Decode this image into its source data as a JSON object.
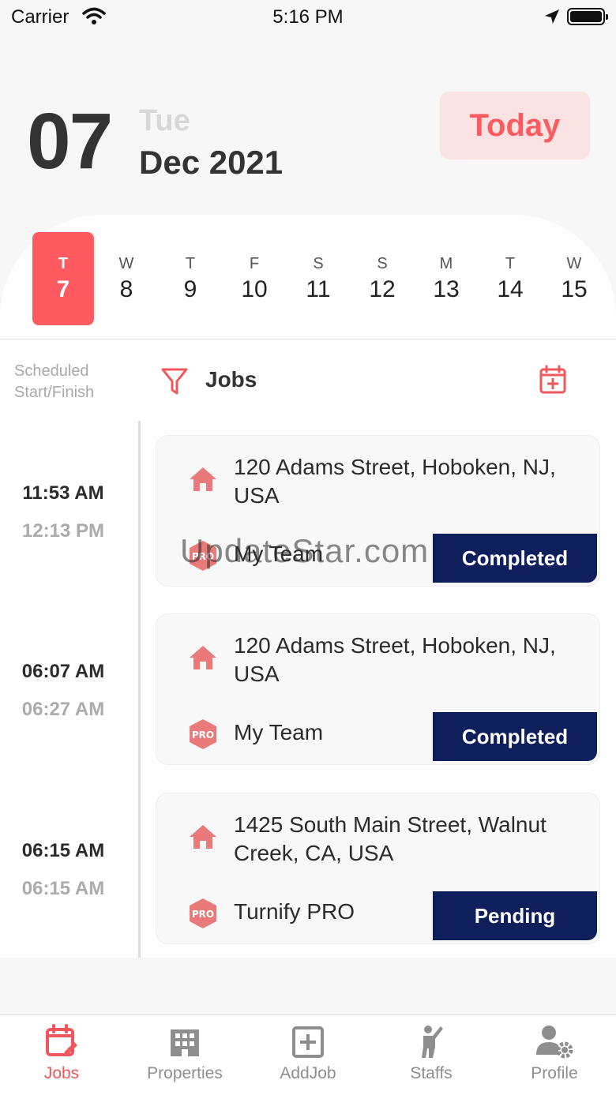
{
  "status_bar": {
    "carrier": "Carrier",
    "time": "5:16 PM"
  },
  "header": {
    "day_number": "07",
    "weekday": "Tue",
    "month_year": "Dec 2021",
    "today_label": "Today"
  },
  "week": [
    {
      "letter": "T",
      "num": "7",
      "active": true
    },
    {
      "letter": "W",
      "num": "8"
    },
    {
      "letter": "T",
      "num": "9"
    },
    {
      "letter": "F",
      "num": "10"
    },
    {
      "letter": "S",
      "num": "11"
    },
    {
      "letter": "S",
      "num": "12"
    },
    {
      "letter": "M",
      "num": "13"
    },
    {
      "letter": "T",
      "num": "14"
    },
    {
      "letter": "W",
      "num": "15"
    }
  ],
  "jobs_section": {
    "sched_label_1": "Scheduled",
    "sched_label_2": "Start/Finish",
    "title": "Jobs"
  },
  "jobs": [
    {
      "start": "11:53 AM",
      "end": "12:13 PM",
      "address": "120 Adams Street, Hoboken, NJ, USA",
      "team": "My Team",
      "status": "Completed"
    },
    {
      "start": "06:07 AM",
      "end": "06:27 AM",
      "address": "120 Adams Street, Hoboken, NJ, USA",
      "team": "My Team",
      "status": "Completed"
    },
    {
      "start": "06:15 AM",
      "end": "06:15 AM",
      "address": "1425 South Main Street, Walnut Creek, CA, USA",
      "team": "Turnify PRO",
      "status": "Pending"
    }
  ],
  "watermark": "UpdateStar.com",
  "tabs": [
    {
      "label": "Jobs",
      "icon": "calendar-edit-icon",
      "active": true
    },
    {
      "label": "Properties",
      "icon": "building-icon"
    },
    {
      "label": "AddJob",
      "icon": "plus-square-icon"
    },
    {
      "label": "Staffs",
      "icon": "person-waving-icon"
    },
    {
      "label": "Profile",
      "icon": "user-gear-icon"
    }
  ],
  "colors": {
    "accent": "#ff5a5f",
    "badge": "#0f1f5c",
    "today_bg": "#fbe3e3"
  }
}
